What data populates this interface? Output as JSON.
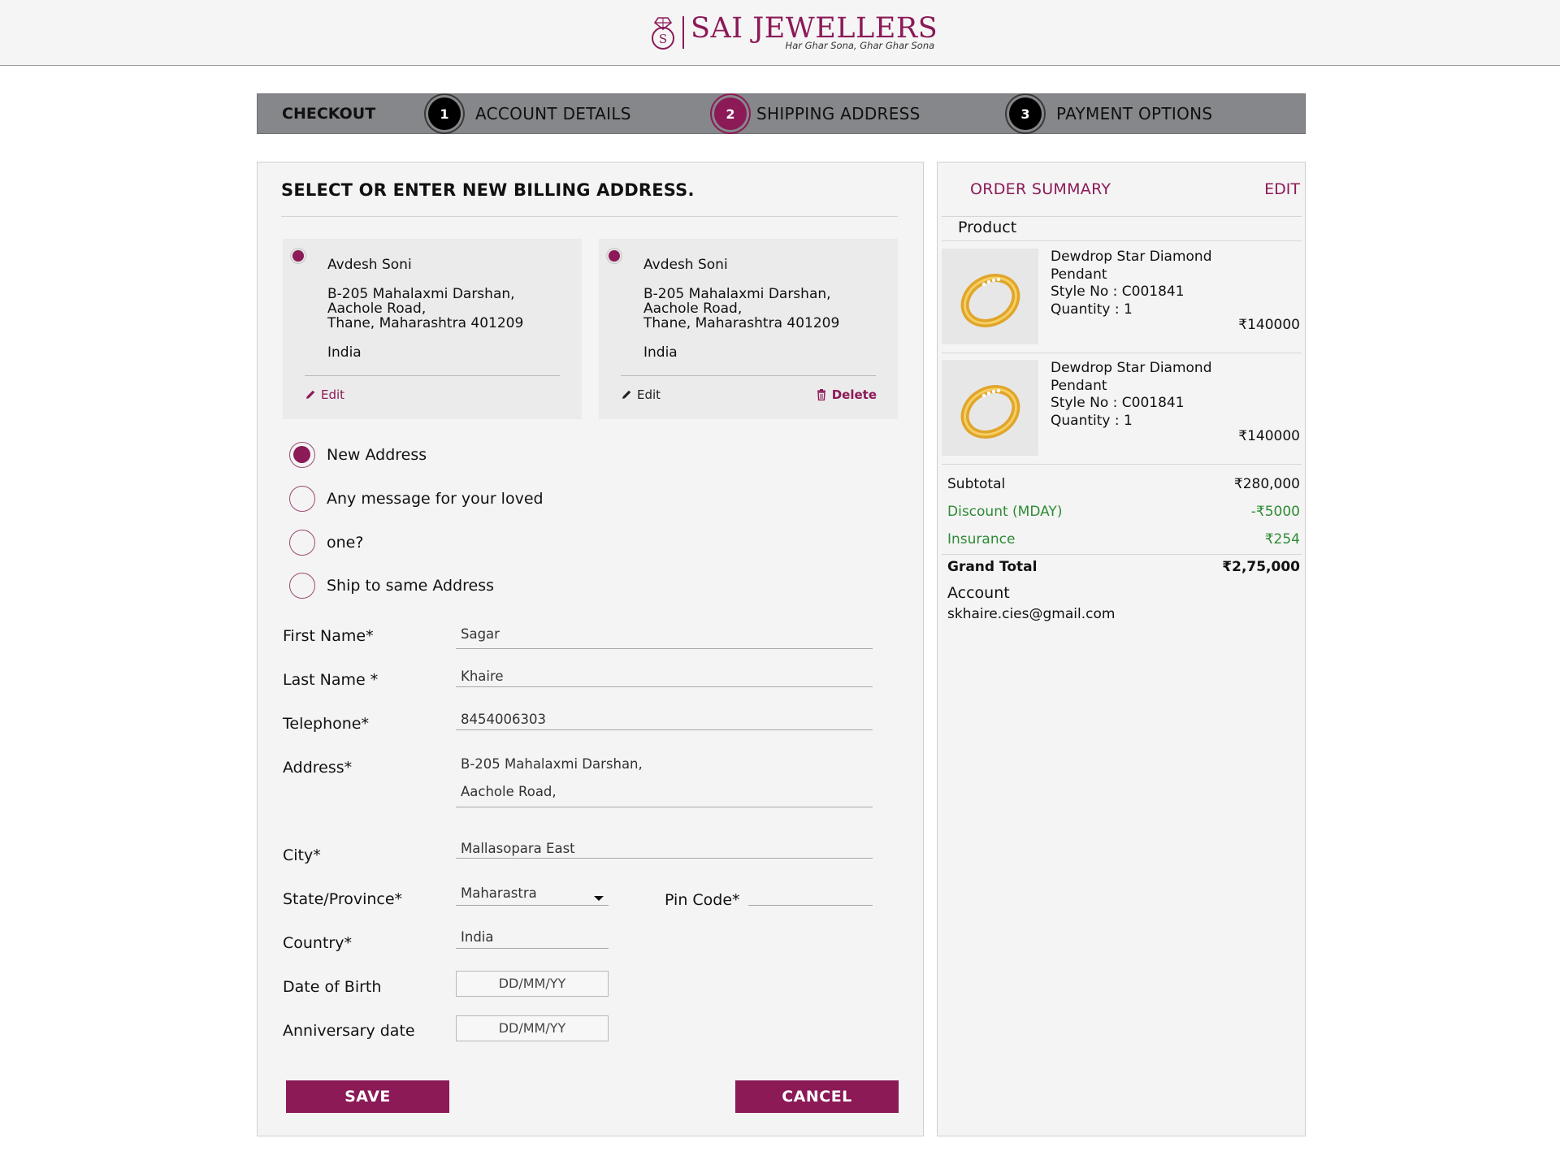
{
  "brand": {
    "name": "SAI JEWELLERS",
    "tagline": "Har Ghar Sona, Ghar Ghar Sona",
    "logo_icon": "diamond-ring-logo-icon"
  },
  "checkout": {
    "title": "CHECKOUT",
    "steps": [
      {
        "num": "1",
        "label": "ACCOUNT DETAILS"
      },
      {
        "num": "2",
        "label": "SHIPPING ADDRESS"
      },
      {
        "num": "3",
        "label": "PAYMENT OPTIONS"
      }
    ],
    "active_step": 2
  },
  "billing": {
    "title": "SELECT OR ENTER NEW BILLING ADDRESS.",
    "cards": [
      {
        "name": "Avdesh Soni",
        "line1": "B-205 Mahalaxmi Darshan,",
        "line2": "Aachole Road,",
        "line3": "Thane, Maharashtra 401209",
        "country": "India",
        "edit_label": "Edit"
      },
      {
        "name": "Avdesh Soni",
        "line1": "B-205 Mahalaxmi Darshan,",
        "line2": "Aachole Road,",
        "line3": "Thane, Maharashtra 401209",
        "country": "India",
        "edit_label": "Edit",
        "delete_label": "Delete"
      }
    ],
    "options": [
      {
        "label": "New Address",
        "selected": true
      },
      {
        "label": "Any message for your loved",
        "selected": false
      },
      {
        "label": "one?",
        "selected": false
      },
      {
        "label": "Ship to same Address",
        "selected": false
      }
    ]
  },
  "form": {
    "first_name_label": "First Name*",
    "first_name_value": "Sagar",
    "last_name_label": "Last Name *",
    "last_name_value": "Khaire",
    "telephone_label": "Telephone*",
    "telephone_value": "8454006303",
    "address_label": "Address*",
    "address_line1": "B-205 Mahalaxmi Darshan,",
    "address_line2": "Aachole Road,",
    "city_label": "City*",
    "city_value": "Mallasopara East",
    "state_label": "State/Province*",
    "state_value": "Maharastra",
    "pin_label": "Pin Code*",
    "pin_value": "",
    "country_label": "Country*",
    "country_value": "India",
    "dob_label": "Date of Birth",
    "dob_placeholder": "DD/MM/YY",
    "anniv_label": "Anniversary date",
    "anniv_placeholder": "DD/MM/YY",
    "save_label": "SAVE",
    "cancel_label": "CANCEL"
  },
  "summary": {
    "title": "ORDER SUMMARY",
    "edit_label": "EDIT",
    "product_header": "Product",
    "items": [
      {
        "name1": "Dewdrop Star Diamond",
        "name2": "Pendant",
        "style": "Style No : C001841",
        "qty": "Quantity : 1",
        "price": "₹140000"
      },
      {
        "name1": "Dewdrop Star Diamond",
        "name2": "Pendant",
        "style": "Style No : C001841",
        "qty": "Quantity : 1",
        "price": "₹140000"
      }
    ],
    "subtotal_label": "Subtotal",
    "subtotal_value": "₹280,000",
    "discount_label": "Discount (MDAY)",
    "discount_value": "-₹5000",
    "insurance_label": "Insurance",
    "insurance_value": "₹254",
    "grand_total_label": "Grand Total",
    "grand_total_value": "₹2,75,000",
    "account_label": "Account",
    "account_email": "skhaire.cies@gmail.com"
  },
  "colors": {
    "accent": "#8b1a57",
    "step_bar": "#86878a",
    "green": "#2e8b34"
  }
}
